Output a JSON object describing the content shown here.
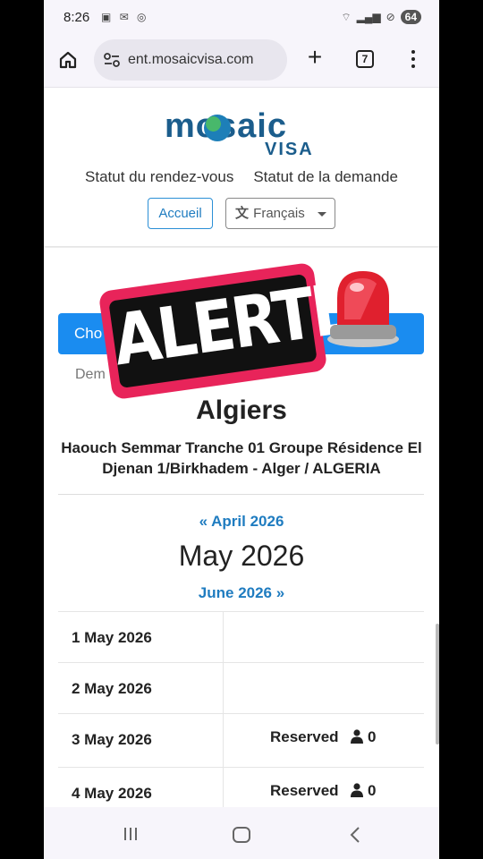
{
  "status_bar": {
    "time": "8:26",
    "battery": "64"
  },
  "browser": {
    "url": "ent.mosaicvisa.com",
    "tab_count": "7",
    "new_tab_symbol": "+"
  },
  "site": {
    "logo_main": "mosaic",
    "logo_sub": "VISA",
    "nav": [
      "Statut du rendez-vous",
      "Statut de la demande"
    ],
    "home_button": "Accueil",
    "language": "Français"
  },
  "content": {
    "choose_bar_text": "Cho",
    "dem_text": "Dem",
    "overlay_text": "ALERTE",
    "center_name": "Algiers",
    "center_address": "Haouch Semmar Tranche 01 Groupe Résidence El Djenan 1/Birkhadem - Alger / ALGERIA",
    "prev_month": "« April 2026",
    "current_month": "May 2026",
    "next_month": "June 2026 »",
    "days": [
      {
        "date": "1 May 2026",
        "status": "",
        "count": ""
      },
      {
        "date": "2 May 2026",
        "status": "",
        "count": ""
      },
      {
        "date": "3 May 2026",
        "status": "Reserved",
        "count": "0"
      },
      {
        "date": "4 May 2026",
        "status": "Reserved",
        "count": "0"
      }
    ]
  },
  "colors": {
    "brand": "#1b5d8c",
    "primary": "#1a8cf0",
    "link": "#1f7cc0",
    "alert_border": "#e8245a"
  }
}
